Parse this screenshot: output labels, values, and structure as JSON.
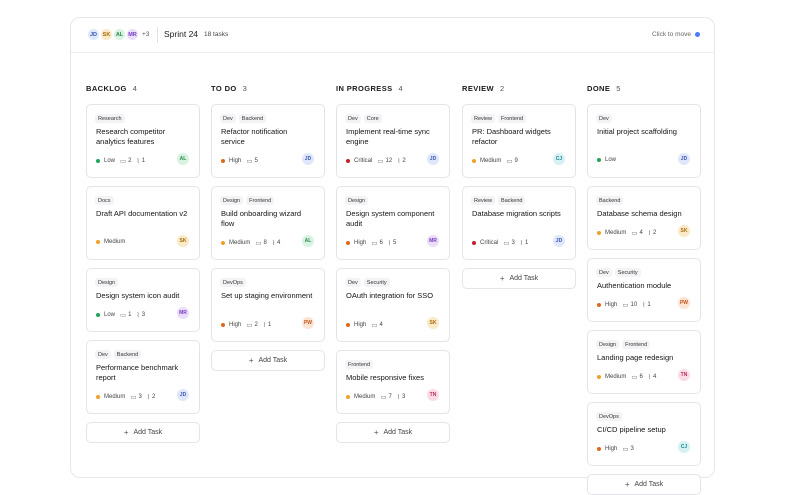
{
  "header": {
    "avatars": [
      {
        "initials": "JD",
        "bg": "#dfe7fb",
        "fg": "#3a57b0"
      },
      {
        "initials": "SK",
        "bg": "#fbeac8",
        "fg": "#a36b12"
      },
      {
        "initials": "AL",
        "bg": "#d9f3e2",
        "fg": "#2f8a4c"
      },
      {
        "initials": "MR",
        "bg": "#eadcfb",
        "fg": "#7a3fc0"
      }
    ],
    "more": "+3",
    "sprint": "Sprint 24",
    "task_count": "18 tasks",
    "click_to_move": "Click to move"
  },
  "colors": {
    "Low": "#22a35a",
    "Medium": "#f0a12a",
    "High": "#e0681c",
    "Critical": "#c2202a"
  },
  "columns": [
    {
      "title": "BACKLOG",
      "count": "4",
      "cards": [
        {
          "tags": [
            "Research"
          ],
          "title": "Research competitor analytics features",
          "priority": "Low",
          "comments": "2",
          "attachments": "1",
          "assignee": "AL"
        },
        {
          "tags": [
            "Docs"
          ],
          "title": "Draft API documentation v2",
          "priority": "Medium",
          "comments": "",
          "attachments": "",
          "assignee": "SK"
        },
        {
          "tags": [
            "Design"
          ],
          "title": "Design system icon audit",
          "priority": "Low",
          "comments": "1",
          "attachments": "3",
          "assignee": "MR"
        },
        {
          "tags": [
            "Dev",
            "Backend"
          ],
          "title": "Performance benchmark report",
          "priority": "Medium",
          "comments": "3",
          "attachments": "2",
          "assignee": "JD"
        }
      ],
      "add_label": "Add Task"
    },
    {
      "title": "TO DO",
      "count": "3",
      "cards": [
        {
          "tags": [
            "Dev",
            "Backend"
          ],
          "title": "Refactor notification service",
          "priority": "High",
          "comments": "5",
          "attachments": "",
          "assignee": "JD"
        },
        {
          "tags": [
            "Design",
            "Frontend"
          ],
          "title": "Build onboarding wizard flow",
          "priority": "Medium",
          "comments": "8",
          "attachments": "4",
          "assignee": "AL"
        },
        {
          "tags": [
            "DevOps"
          ],
          "title": "Set up staging environment",
          "priority": "High",
          "comments": "2",
          "attachments": "1",
          "assignee": "PW"
        }
      ],
      "add_label": "Add Task"
    },
    {
      "title": "IN PROGRESS",
      "count": "4",
      "cards": [
        {
          "tags": [
            "Dev",
            "Core"
          ],
          "title": "Implement real-time sync engine",
          "priority": "Critical",
          "comments": "12",
          "attachments": "2",
          "assignee": "JD"
        },
        {
          "tags": [
            "Design"
          ],
          "title": "Design system component audit",
          "priority": "High",
          "comments": "6",
          "attachments": "5",
          "assignee": "MR"
        },
        {
          "tags": [
            "Dev",
            "Security"
          ],
          "title": "OAuth integration for SSO",
          "priority": "High",
          "comments": "4",
          "attachments": "",
          "assignee": "SK"
        },
        {
          "tags": [
            "Frontend"
          ],
          "title": "Mobile responsive fixes",
          "priority": "Medium",
          "comments": "7",
          "attachments": "3",
          "assignee": "TN"
        }
      ],
      "add_label": "Add Task"
    },
    {
      "title": "REVIEW",
      "count": "2",
      "cards": [
        {
          "tags": [
            "Review",
            "Frontend"
          ],
          "title": "PR: Dashboard widgets refactor",
          "priority": "Medium",
          "comments": "9",
          "attachments": "",
          "assignee": "CJ"
        },
        {
          "tags": [
            "Review",
            "Backend"
          ],
          "title": "Database migration scripts",
          "priority": "Critical",
          "comments": "3",
          "attachments": "1",
          "assignee": "JD"
        }
      ],
      "add_label": "Add Task"
    },
    {
      "title": "DONE",
      "count": "5",
      "cards": [
        {
          "tags": [
            "Dev"
          ],
          "title": "Initial project scaffolding",
          "priority": "Low",
          "comments": "",
          "attachments": "",
          "assignee": "JD"
        },
        {
          "tags": [
            "Backend"
          ],
          "title": "Database schema design",
          "priority": "Medium",
          "comments": "4",
          "attachments": "2",
          "assignee": "SK"
        },
        {
          "tags": [
            "Dev",
            "Security"
          ],
          "title": "Authentication module",
          "priority": "High",
          "comments": "10",
          "attachments": "1",
          "assignee": "PW"
        },
        {
          "tags": [
            "Design",
            "Frontend"
          ],
          "title": "Landing page redesign",
          "priority": "Medium",
          "comments": "6",
          "attachments": "4",
          "assignee": "TN"
        },
        {
          "tags": [
            "DevOps"
          ],
          "title": "CI/CD pipeline setup",
          "priority": "High",
          "comments": "3",
          "attachments": "",
          "assignee": "CJ"
        }
      ],
      "add_label": "Add Task"
    }
  ],
  "assignee_colors": {
    "JD": {
      "bg": "#dfe7fb",
      "fg": "#3a57b0"
    },
    "SK": {
      "bg": "#fbeac8",
      "fg": "#a36b12"
    },
    "AL": {
      "bg": "#d9f3e2",
      "fg": "#2f8a4c"
    },
    "MR": {
      "bg": "#eadcfb",
      "fg": "#7a3fc0"
    },
    "PW": {
      "bg": "#fde3d3",
      "fg": "#c0561b"
    },
    "TN": {
      "bg": "#fbdbe5",
      "fg": "#b72f5c"
    },
    "CJ": {
      "bg": "#d5f1f4",
      "fg": "#1f8594"
    }
  }
}
